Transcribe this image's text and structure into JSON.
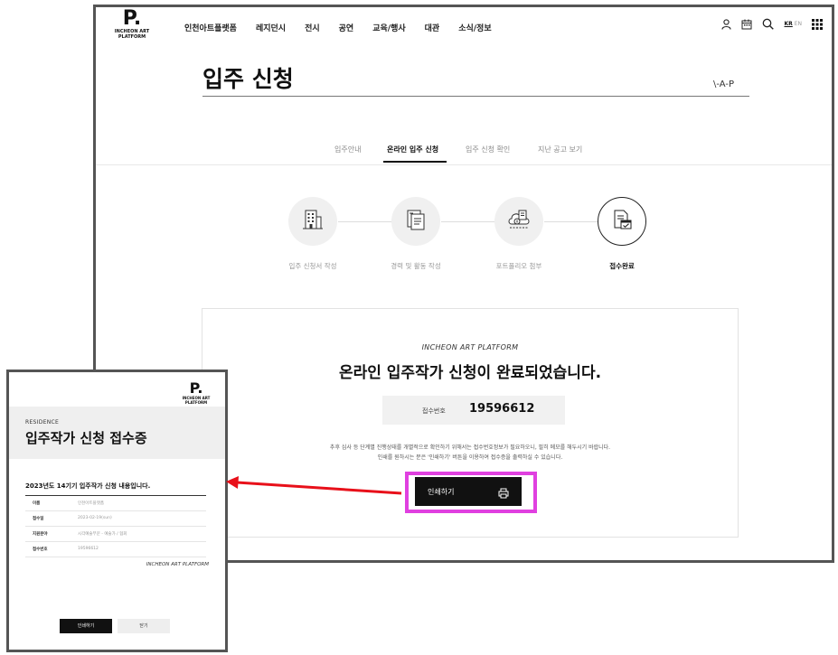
{
  "logo": {
    "mark": "P.",
    "text_line1": "INCHEON ART",
    "text_line2": "PLATFORM"
  },
  "nav": {
    "items": [
      {
        "label": "인천아트플랫폼"
      },
      {
        "label": "레지던시"
      },
      {
        "label": "전시"
      },
      {
        "label": "공연"
      },
      {
        "label": "교육/행사"
      },
      {
        "label": "대관"
      },
      {
        "label": "소식/정보"
      }
    ],
    "icons": [
      "user-icon",
      "calendar-icon",
      "search-icon",
      "grid-menu-icon"
    ],
    "lang_kr": "KR",
    "lang_en": "EN"
  },
  "page": {
    "title": "입주 신청",
    "side_mark": "\\-A-P"
  },
  "tabs": [
    {
      "label": "입주안내",
      "active": false
    },
    {
      "label": "온라인 입주 신청",
      "active": true
    },
    {
      "label": "입주 신청 확인",
      "active": false
    },
    {
      "label": "지난 공고 보기",
      "active": false
    }
  ],
  "steps": [
    {
      "label": "입주 신청서 작성",
      "icon": "building-icon",
      "done": false
    },
    {
      "label": "경력 및 활동 작성",
      "icon": "document-list-icon",
      "done": false
    },
    {
      "label": "포트폴리오 첨부",
      "icon": "cloud-upload-icon",
      "done": false
    },
    {
      "label": "접수완료",
      "icon": "document-check-icon",
      "done": true
    }
  ],
  "result": {
    "brand": "INCHEON ART PLATFORM",
    "message": "온라인 입주작가 신청이 완료되었습니다.",
    "receipt_label": "접수번호",
    "receipt_number": "19596612",
    "notice_line1": "추후 심사 등 단계별 진행상태를 개별적으로 확인하기 위해서는 접수번호정보가 필요하오니, 필히 메모를 해두시기 바랍니다.",
    "notice_line2": "인쇄를 원하시는 분은 '인쇄하기' 버튼을 이용하여 접수증을 출력하실 수 있습니다.",
    "print_label": "인쇄하기"
  },
  "receipt": {
    "residence": "RESIDENCE",
    "title": "입주작가 신청 접수증",
    "subtitle": "2023년도 14기기 입주작가 신청 내용입니다.",
    "rows": [
      {
        "key": "이름",
        "value": "인천아트플랫폼"
      },
      {
        "key": "접수일",
        "value": "2023-02-19(sun)"
      },
      {
        "key": "지원분야",
        "value": "시각예술부문 - 예술가 / 협회"
      },
      {
        "key": "접수번호",
        "value": "19596612"
      }
    ],
    "brand": "INCHEON ART PLATFORM",
    "print_button": "인쇄하기",
    "close_button": "닫기"
  },
  "colors": {
    "highlight": "#e040e0",
    "arrow": "#e8101a"
  }
}
